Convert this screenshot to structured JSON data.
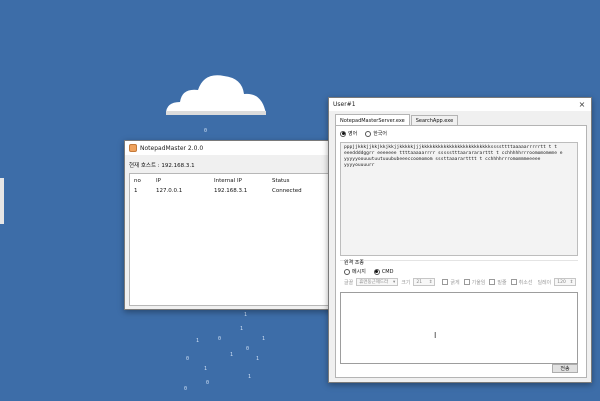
{
  "notepad": {
    "title": "NotepadMaster 2.0.0",
    "server_line": "현재 호스트 : 192.168.3.1",
    "columns": [
      "no",
      "IP",
      "Internal IP",
      "Status"
    ],
    "rows": [
      {
        "no": "1",
        "ip": "127.0.0.1",
        "internal_ip": "192.168.3.1",
        "status": "Connected"
      }
    ]
  },
  "user": {
    "title": "User#1",
    "close": "×",
    "tabs": [
      "NotepadMasterServer.exe",
      "SearchApp.exe"
    ],
    "lang_options": [
      "영어",
      "한국어"
    ],
    "received_text": "pppjjkkkjjkkjkkjkkjjkkkkkjjjkkkkkkkkkkkkkkkkkkkkkkkkkssssttttaaaaarrrrrtt t t\neeeddddggrr eeeeeee ttttaaaaarrrr ssssstttaararararttt t cchhhhhrrroomomomeme e\nyyyyyoouuutuutuuububeeeccoomomom sssttaaarartttt t cchhhhrrromommmeeeee\nyyyyouuuurr",
    "group_label": "원격 조종",
    "mode_options": [
      "메시지",
      "CMD"
    ],
    "opt_font_label": "글꼴",
    "opt_font_value": "휴먼둥근헤드라",
    "opt_size_label": "크기",
    "opt_size_value": "21",
    "opt_bold": "굵게",
    "opt_italic": "기울임",
    "opt_underline": "밑줄",
    "opt_strike": "취소선",
    "opt_delay_label": "딜레이",
    "opt_delay_value": "120",
    "send_label": "전송"
  },
  "colors": {
    "desktop": "#3d6da8",
    "window_bg": "#f0f0f0",
    "rain": "#cfe0f5"
  }
}
